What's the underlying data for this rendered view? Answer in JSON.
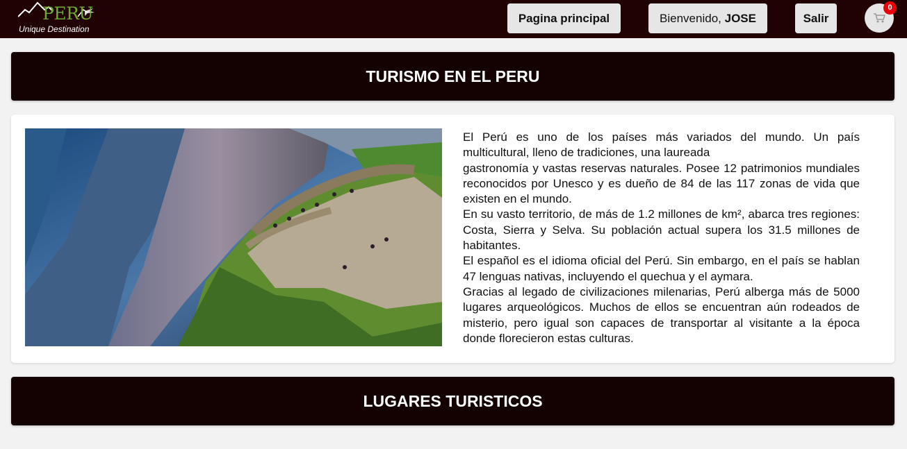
{
  "navbar": {
    "logo": {
      "word": "PERU",
      "tagline": "Unique Destination"
    },
    "home_label": "Pagina principal",
    "welcome_prefix": "Bienvenido, ",
    "welcome_user": "JOSE",
    "logout_label": "Salir",
    "cart_icon": "cart-icon",
    "cart_count": "0"
  },
  "sections": {
    "tourism_title": "TURISMO EN EL PERU",
    "places_title": "LUGARES TURISTICOS"
  },
  "intro": {
    "paragraphs": [
      "El Perú es uno de los países más variados del mundo. Un país multicultural, lleno de tradiciones, una laureada",
      "gastronomía y vastas reservas naturales. Posee 12 patrimonios mundiales reconocidos por Unesco y es dueño de 84 de las 117 zonas de vida que existen en el mundo.",
      "En su vasto territorio, de más de 1.2 millones de km², abarca tres regiones: Costa, Sierra y Selva. Su población actual supera los 31.5 millones de habitantes.",
      "El español es el idioma oficial del Perú. Sin embargo, en el país se hablan 47 lenguas nativas, incluyendo el quechua y el aymara.",
      "Gracias al legado de civilizaciones milenarias, Perú alberga más de 5000 lugares arqueológicos. Muchos de ellos se encuentran aún rodeados de misterio, pero igual son capaces de transportar al visitante a la época donde florecieron estas culturas."
    ]
  },
  "colors": {
    "navbar": "#210203",
    "banner": "#140203",
    "page": "#f2f2f2",
    "logo_green": "#6ea82c",
    "badge": "#e8000b"
  }
}
